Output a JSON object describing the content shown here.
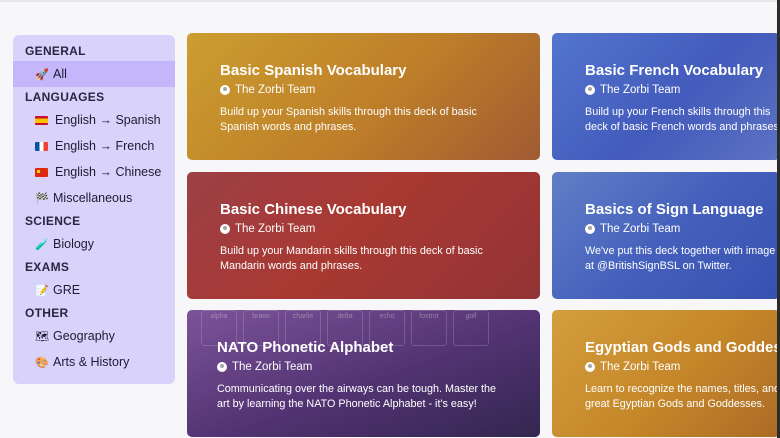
{
  "sidebar": {
    "sections": [
      {
        "title": "GENERAL",
        "items": [
          {
            "label": "All",
            "icon": "rocket-icon",
            "active": true
          }
        ]
      },
      {
        "title": "LANGUAGES",
        "items": [
          {
            "label": "English → Spanish",
            "icon": "spain-flag-icon"
          },
          {
            "label": "English → French",
            "icon": "france-flag-icon"
          },
          {
            "label": "English → Chinese",
            "icon": "china-flag-icon"
          },
          {
            "label": "Miscellaneous",
            "icon": "checkered-flag-icon"
          }
        ]
      },
      {
        "title": "SCIENCE",
        "items": [
          {
            "label": "Biology",
            "icon": "test-tube-icon"
          }
        ]
      },
      {
        "title": "EXAMS",
        "items": [
          {
            "label": "GRE",
            "icon": "memo-icon"
          }
        ]
      },
      {
        "title": "OTHER",
        "items": [
          {
            "label": "Geography",
            "icon": "map-icon"
          },
          {
            "label": "Arts & History",
            "icon": "palette-icon"
          }
        ]
      }
    ]
  },
  "cards": [
    {
      "title": "Basic Spanish Vocabulary",
      "team": "The Zorbi Team",
      "description": "Build up your Spanish skills through this deck of basic Spanish words and phrases."
    },
    {
      "title": "Basic French Vocabulary",
      "team": "The Zorbi Team",
      "description": "Build up your French skills through this deck of basic French words and phrases."
    },
    {
      "title": "Basic Chinese Vocabulary",
      "team": "The Zorbi Team",
      "description": "Build up your Mandarin skills through this deck of basic Mandarin words and phrases."
    },
    {
      "title": "Basics of Sign Language",
      "team": "The Zorbi Team",
      "description": "We've put this deck together with image at @BritishSignBSL on Twitter."
    },
    {
      "title": "NATO Phonetic Alphabet",
      "team": "The Zorbi Team",
      "description": "Communicating over the airways can be tough. Master the art by learning the NATO Phonetic Alphabet - it's easy!"
    },
    {
      "title": "Egyptian Gods and Goddess",
      "team": "The Zorbi Team",
      "description": "Learn to recognize the names, titles, and great Egyptian Gods and Goddesses."
    }
  ],
  "nato_keys": [
    "alpha",
    "bravo",
    "charlie",
    "delta",
    "echo",
    "foxtrot",
    "golf"
  ]
}
